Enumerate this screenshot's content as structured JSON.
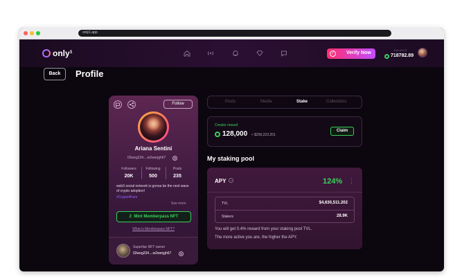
{
  "browser": {
    "url": "only1.app"
  },
  "app": {
    "logo_text": "only¹",
    "nav_icons": [
      "home-icon",
      "broadcast-icon",
      "bell-icon",
      "diamond-icon",
      "chat-icon"
    ],
    "verify_label": "Verify Now",
    "balance_label": "BALANCE",
    "balance": "718782.89",
    "colors": {
      "accent_green": "#39d15a",
      "accent_pink": "#ff2e6e",
      "accent_purple": "#c24dff",
      "background": "#0c060f"
    }
  },
  "page": {
    "back_label": "Back",
    "title": "Profile"
  },
  "profile": {
    "follow_label": "Follow",
    "name": "Ariana Sentini",
    "address": "02weg234....w2werjgh67",
    "stats": [
      {
        "label": "Followers",
        "value": "20K"
      },
      {
        "label": "Following",
        "value": "500"
      },
      {
        "label": "Posts",
        "value": "235"
      }
    ],
    "bio": "web3 social network is gonna be the next wave of crypto adoption!",
    "hashtag": "#Crypto4Fam",
    "see_more": "See more",
    "mint_label": "Mint Memberpass NFT",
    "mint_number": "2",
    "mint_link": "What is Memberpass NFT?",
    "owner_label": "Superfan NFT owner",
    "owner_address": "02weg234....w2werjgh67"
  },
  "tabs": [
    {
      "label": "Posts",
      "active": false
    },
    {
      "label": "Media",
      "active": false
    },
    {
      "label": "Stake",
      "active": true
    },
    {
      "label": "Collections",
      "active": false
    }
  ],
  "reward": {
    "label": "Creator reward",
    "amount": "128,000",
    "usd": "≈ $256,223.201",
    "claim_label": "Claim"
  },
  "staking": {
    "title": "My staking pool",
    "apy_label": "APY",
    "apy_value": "124%",
    "tvl_label": "TVL",
    "tvl_value": "$4,630,511.202",
    "stakers_label": "Stakers",
    "stakers_value": "28.9K",
    "note_1": "You will get 0.4% reward from your staking pool TVL.",
    "note_2": "The more active you are, the higher the APY."
  }
}
